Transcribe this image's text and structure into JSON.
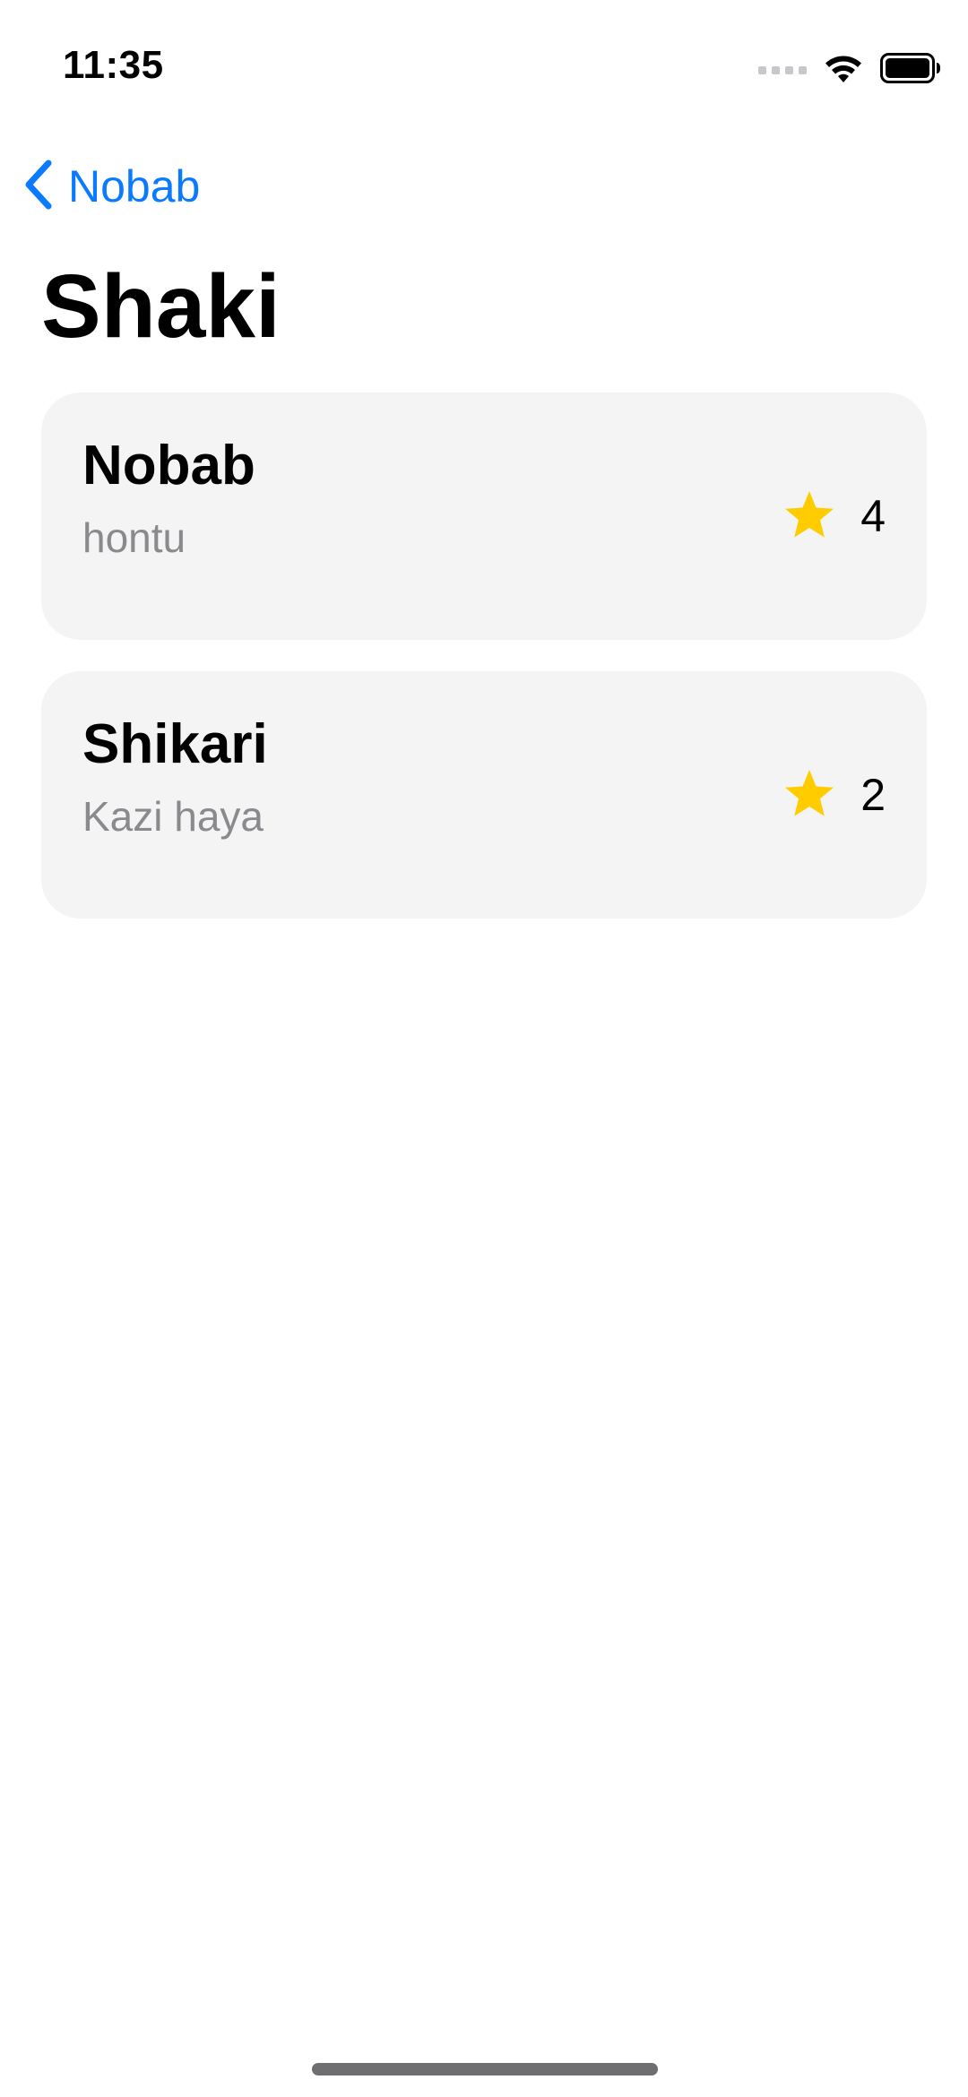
{
  "status_bar": {
    "time": "11:35"
  },
  "nav": {
    "back_label": "Nobab"
  },
  "page": {
    "title": "Shaki"
  },
  "items": [
    {
      "title": "Nobab",
      "subtitle": "hontu",
      "rating": "4",
      "icon": "star-icon"
    },
    {
      "title": "Shikari",
      "subtitle": "Kazi haya",
      "rating": "2",
      "icon": "star-icon"
    }
  ],
  "colors": {
    "accent": "#0a7aff",
    "star": "#ffcc00",
    "card_background": "#f4f4f4",
    "subtitle": "#8a8a8e"
  }
}
